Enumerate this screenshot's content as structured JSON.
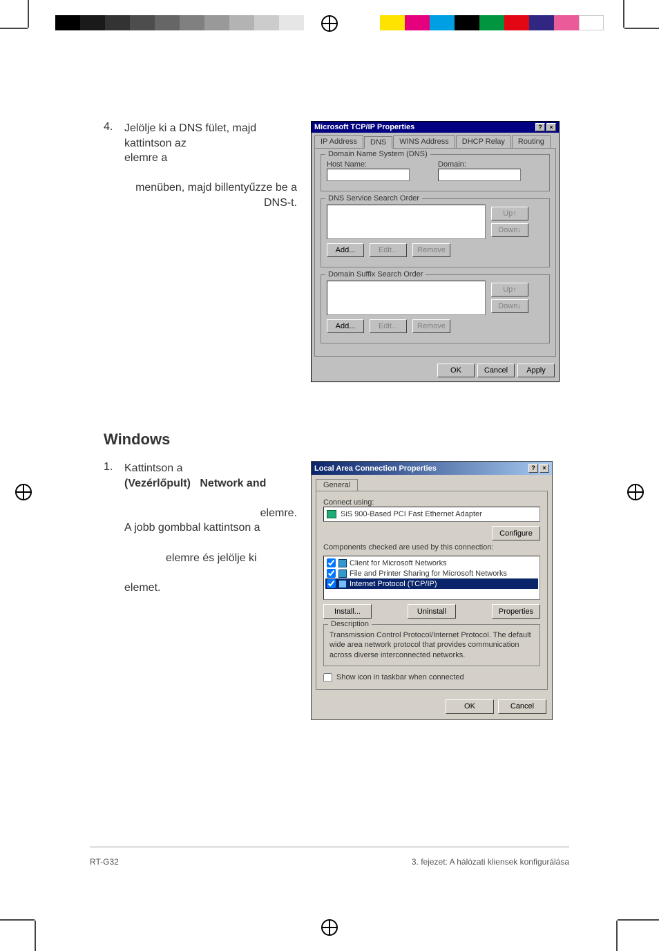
{
  "step4": {
    "num": "4.",
    "line1": "Jelölje ki a DNS fület, majd kattintson az",
    "line2": "elemre a",
    "line3_suffix": "menüben, majd billentyűzze be a DNS-t."
  },
  "dlg9x": {
    "title": "Microsoft TCP/IP Properties",
    "help_btn": "?",
    "close_btn": "×",
    "tabs": {
      "ip": "IP Address",
      "dns": "DNS",
      "wins": "WINS Address",
      "dhcp": "DHCP Relay",
      "routing": "Routing"
    },
    "group_dns": "Domain Name System (DNS)",
    "host_label": "Host Name:",
    "domain_label": "Domain:",
    "group_service": "DNS Service Search Order",
    "group_suffix": "Domain Suffix Search Order",
    "btn_add": "Add...",
    "btn_edit": "Edit...",
    "btn_remove": "Remove",
    "btn_up": "Up↑",
    "btn_down": "Down↓",
    "btn_ok": "OK",
    "btn_cancel": "Cancel",
    "btn_apply": "Apply"
  },
  "heading_windows": "Windows",
  "step1": {
    "num": "1.",
    "line1_a": "Kattintson a",
    "line1_b": "(Vezérlőpult)",
    "line1_c": "Network and",
    "line2_suffix": "elemre.",
    "line3": "A jobb gombbal kattintson a",
    "line4_suffix": "elemre és jelölje ki",
    "line5": "elemet."
  },
  "dlg2k": {
    "title": "Local Area Connection Properties",
    "help_btn": "?",
    "close_btn": "×",
    "tab_general": "General",
    "connect_using": "Connect using:",
    "adapter": "SiS 900-Based PCI Fast Ethernet Adapter",
    "btn_configure": "Configure",
    "components_label": "Components checked are used by this connection:",
    "comp1": "Client for Microsoft Networks",
    "comp2": "File and Printer Sharing for Microsoft Networks",
    "comp3": "Internet Protocol (TCP/IP)",
    "btn_install": "Install...",
    "btn_uninstall": "Uninstall",
    "btn_properties": "Properties",
    "group_desc": "Description",
    "desc_text": "Transmission Control Protocol/Internet Protocol. The default wide area network protocol that provides communication across diverse interconnected networks.",
    "show_icon": "Show icon in taskbar when connected",
    "btn_ok": "OK",
    "btn_cancel": "Cancel"
  },
  "footer": {
    "left": "RT-G32",
    "right": "3. fejezet: A hálózati kliensek konfigurálása"
  }
}
